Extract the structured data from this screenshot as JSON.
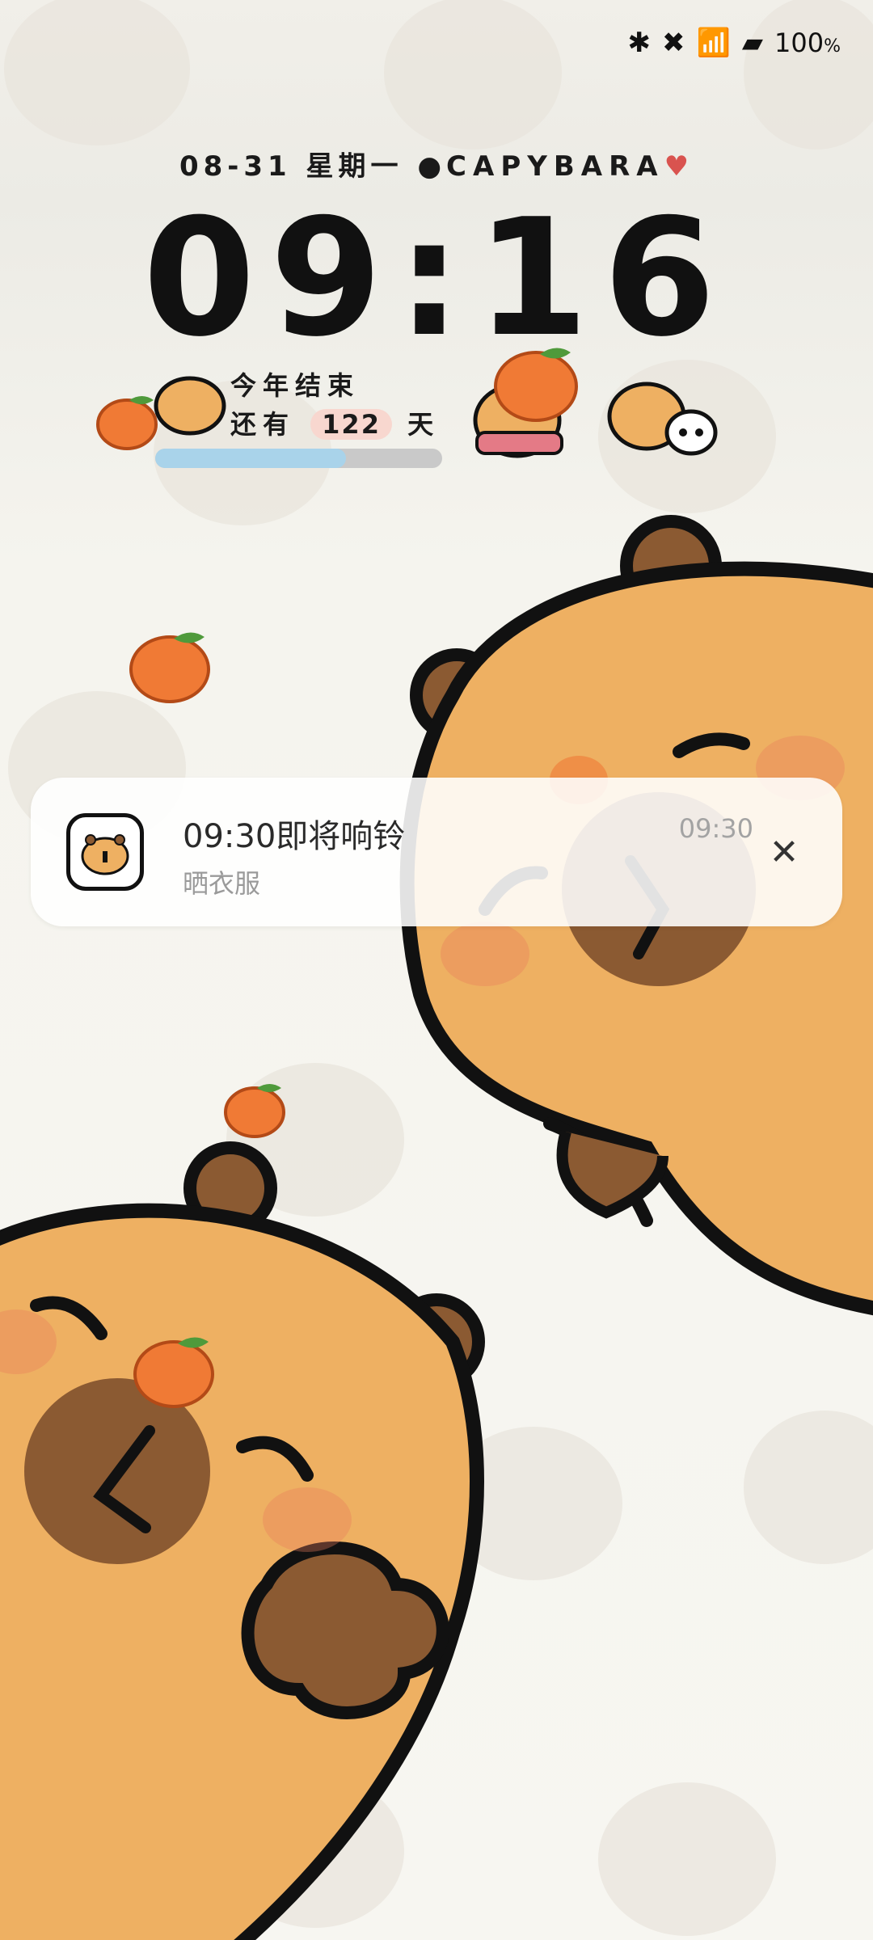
{
  "status_bar": {
    "battery_percent": "100",
    "battery_unit": "%",
    "icons": [
      "bluetooth-icon",
      "nfc-icon",
      "wifi-icon",
      "capybara-battery-icon"
    ]
  },
  "lockscreen": {
    "date": "08-31",
    "weekday": "星期一",
    "brand": "CAPYBARA",
    "time": "09:16"
  },
  "year_widget": {
    "line1": "今年结束",
    "line2_prefix": "还有",
    "days_left": "122",
    "line2_suffix": "天",
    "year_progress_fraction": 0.665
  },
  "notification": {
    "title": "09:30即将响铃",
    "subtitle": "晒衣服",
    "time": "09:30",
    "close_icon": "close-icon"
  },
  "colors": {
    "capybara_body": "#eeb062",
    "capybara_dark": "#8b5a32",
    "orange": "#f07a35",
    "leaf": "#4f9a3b",
    "progress_fill": "#a9d3ea"
  }
}
